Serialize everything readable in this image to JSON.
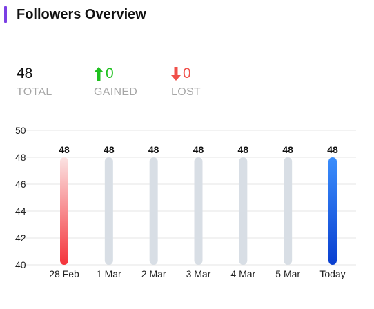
{
  "header": {
    "title": "Followers Overview",
    "accent_color": "#7b3fe4"
  },
  "stats": {
    "total": {
      "value": "48",
      "label": "TOTAL"
    },
    "gained": {
      "value": "0",
      "label": "GAINED",
      "color": "#1fc11f",
      "icon": "arrow-up-icon"
    },
    "lost": {
      "value": "0",
      "label": "LOST",
      "color": "#f0504a",
      "icon": "arrow-down-icon"
    }
  },
  "chart_data": {
    "type": "bar",
    "categories": [
      "28 Feb",
      "1 Mar",
      "2 Mar",
      "3 Mar",
      "4 Mar",
      "5 Mar",
      "Today"
    ],
    "values": [
      48,
      48,
      48,
      48,
      48,
      48,
      48
    ],
    "data_labels": [
      "48",
      "48",
      "48",
      "48",
      "48",
      "48",
      "48"
    ],
    "ylim": [
      40,
      50
    ],
    "yticks": [
      "40",
      "42",
      "44",
      "46",
      "48",
      "50"
    ],
    "grid": true,
    "colors": {
      "first_bar": [
        "#fbe3e3",
        "#f4333a"
      ],
      "today_bar": [
        "#3b8efc",
        "#0a3fd0"
      ],
      "default_bar": "#d8dee5",
      "grid": "#e6e6e6"
    }
  }
}
